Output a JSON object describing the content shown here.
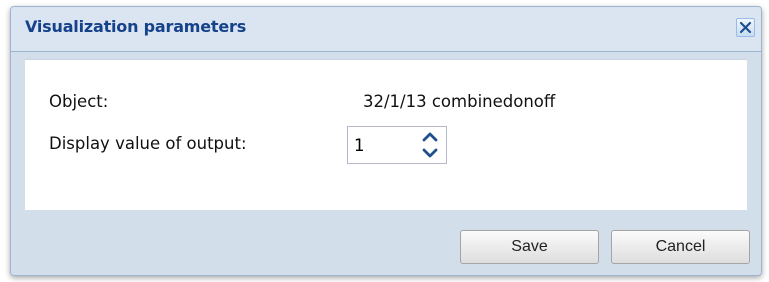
{
  "dialog": {
    "title": "Visualization parameters",
    "close_icon": "close-icon"
  },
  "form": {
    "object_label": "Object:",
    "object_value": "32/1/13 combinedonoff",
    "display_label": "Display value of output:",
    "display_value": "1",
    "spin_up_icon": "chevron-up-icon",
    "spin_down_icon": "chevron-down-icon"
  },
  "footer": {
    "save_label": "Save",
    "cancel_label": "Cancel"
  },
  "colors": {
    "title_text": "#15428b",
    "frame": "#d3deeb",
    "accent_arrow": "#1f4f8f"
  }
}
